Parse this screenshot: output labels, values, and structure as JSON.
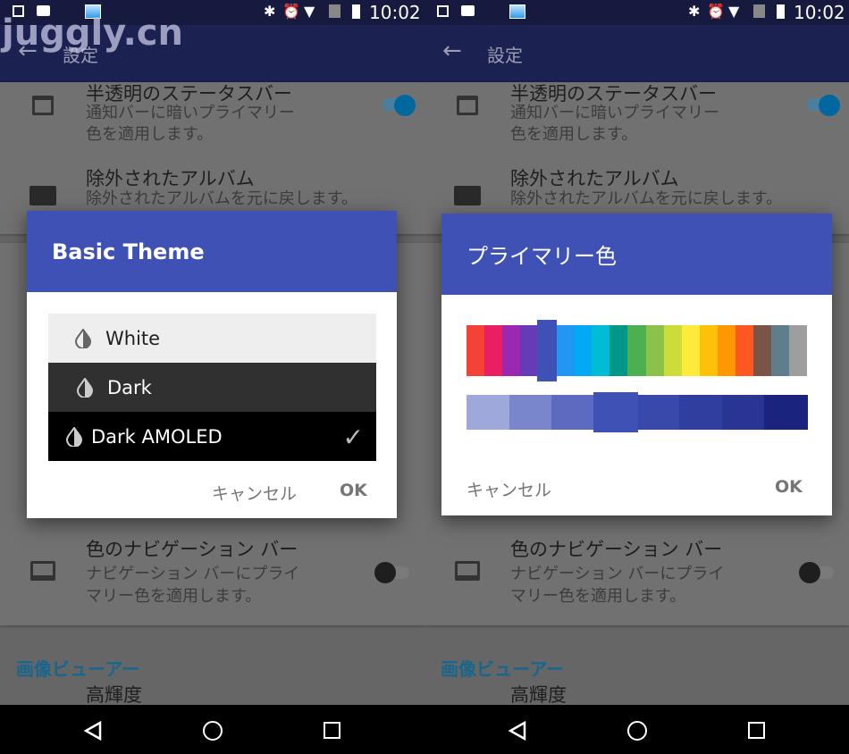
{
  "watermark": "juggly.cn",
  "status": {
    "time": "10:02",
    "icons": [
      "image-icon",
      "message-icon",
      "app-icon",
      "bluetooth-icon",
      "alarm-icon",
      "wifi-icon",
      "no-sim-icon",
      "battery-icon"
    ]
  },
  "toolbar": {
    "title": "設定",
    "back_icon": "arrow-left-icon"
  },
  "settings": {
    "item1": {
      "title": "半透明のステータスバー",
      "sub1": "通知バーに暗いプライマリー",
      "sub2": "色を適用します。",
      "toggle_on": true
    },
    "item2": {
      "title": "除外されたアルバム",
      "sub": "除外されたアルバムを元に戻します。"
    },
    "item3": {
      "title": "色のナビゲーション バー",
      "sub1": "ナビゲーション バーにプライ",
      "sub2": "マリー色を適用します。",
      "toggle_on": false
    },
    "section2": "画像ビューアー",
    "item4": {
      "title": "高輝度"
    }
  },
  "theme_dialog": {
    "title": "Basic Theme",
    "options": [
      {
        "label": "White",
        "selected": false
      },
      {
        "label": "Dark",
        "selected": false
      },
      {
        "label": "Dark AMOLED",
        "selected": true
      }
    ],
    "cancel": "キャンセル",
    "ok": "OK"
  },
  "color_dialog": {
    "title": "プライマリー色",
    "primary_colors": [
      "#f44336",
      "#e91e63",
      "#9c27b0",
      "#673ab7",
      "#3f51b5",
      "#2196f3",
      "#03a9f4",
      "#00bcd4",
      "#009688",
      "#4caf50",
      "#8bc34a",
      "#cddc39",
      "#ffeb3b",
      "#ffc107",
      "#ff9800",
      "#ff5722",
      "#795548",
      "#607d8b",
      "#9e9e9e"
    ],
    "selected_primary": 4,
    "shades": [
      "#9fa8da",
      "#7986cb",
      "#5c6bc0",
      "#3f51b5",
      "#3949ab",
      "#303f9f",
      "#283593",
      "#1a237e"
    ],
    "selected_shade": 3,
    "cancel": "キャンセル",
    "ok": "OK"
  },
  "nav": {
    "back": "back-triangle-icon",
    "home": "home-circle-icon",
    "recents": "recents-square-icon"
  }
}
